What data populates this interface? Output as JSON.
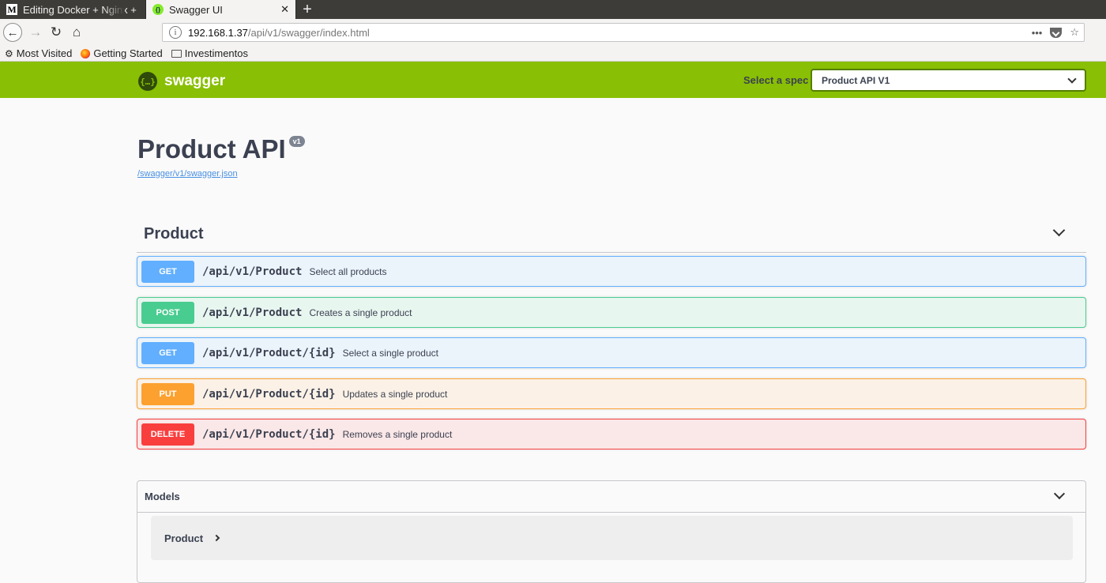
{
  "browser": {
    "tabs": [
      {
        "title": "Editing Docker + Nginx +",
        "favicon": "medium-icon",
        "active": false
      },
      {
        "title": "Swagger UI",
        "favicon": "swagger-icon",
        "active": true
      }
    ],
    "url": {
      "host": "192.168.1.37",
      "path": "/api/v1/swagger/index.html"
    },
    "bookmarks": [
      {
        "label": "Most Visited",
        "icon": "gear-icon"
      },
      {
        "label": "Getting Started",
        "icon": "firefox-icon"
      },
      {
        "label": "Investimentos",
        "icon": "folder-icon"
      }
    ]
  },
  "topbar": {
    "logo_text": "swagger",
    "spec_label": "Select a spec",
    "spec_selected": "Product API V1",
    "brand_color": "#89bf04"
  },
  "info": {
    "title": "Product API",
    "version": "v1",
    "spec_link": "/swagger/v1/swagger.json"
  },
  "tag": {
    "name": "Product",
    "operations": [
      {
        "method": "GET",
        "path": "/api/v1/Product",
        "summary": "Select all products",
        "color": "#61affe"
      },
      {
        "method": "POST",
        "path": "/api/v1/Product",
        "summary": "Creates a single product",
        "color": "#49cc90"
      },
      {
        "method": "GET",
        "path": "/api/v1/Product/{id}",
        "summary": "Select a single product",
        "color": "#61affe"
      },
      {
        "method": "PUT",
        "path": "/api/v1/Product/{id}",
        "summary": "Updates a single product",
        "color": "#fca130"
      },
      {
        "method": "DELETE",
        "path": "/api/v1/Product/{id}",
        "summary": "Removes a single product",
        "color": "#f93e3e"
      }
    ]
  },
  "models": {
    "title": "Models",
    "items": [
      {
        "name": "Product"
      }
    ]
  }
}
